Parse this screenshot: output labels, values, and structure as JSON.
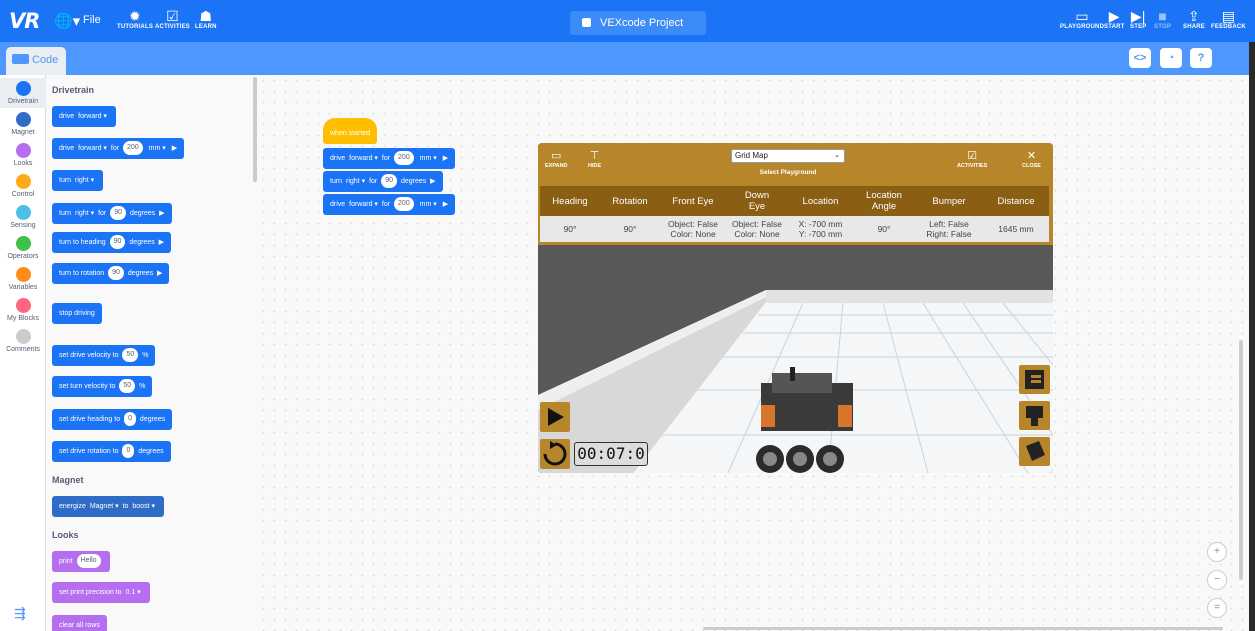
{
  "topbar": {
    "logo": "VR",
    "globe_icon": "globe-icon",
    "file_label": "File",
    "tutorials_label": "TUTORIALS",
    "activities_label": "ACTIVITIES",
    "learn_label": "LEARN",
    "project_title": "VEXcode Project",
    "playground_label": "PLAYGROUND",
    "start_label": "START",
    "step_label": "STEP",
    "stop_label": "STOP",
    "share_label": "SHARE",
    "feedback_label": "FEEDBACK"
  },
  "tabs": {
    "code_label": "Code"
  },
  "categories": [
    {
      "label": "Drivetrain",
      "color": "#1a74f5"
    },
    {
      "label": "Magnet",
      "color": "#2f6cc8"
    },
    {
      "label": "Looks",
      "color": "#b56ef0"
    },
    {
      "label": "Control",
      "color": "#ffab19"
    },
    {
      "label": "Sensing",
      "color": "#4cbfe6"
    },
    {
      "label": "Operators",
      "color": "#40bf4a"
    },
    {
      "label": "Variables",
      "color": "#ff8c1a"
    },
    {
      "label": "My Blocks",
      "color": "#ff6680"
    },
    {
      "label": "Comments",
      "color": "#cccccc"
    }
  ],
  "palette": {
    "drivetrain_title": "Drivetrain",
    "drive": {
      "cmd": "drive",
      "dir": "forward"
    },
    "drive_for": {
      "cmd": "drive",
      "dir": "forward",
      "for": "for",
      "value": "200",
      "unit": "mm"
    },
    "turn": {
      "cmd": "turn",
      "dir": "right"
    },
    "turn_for": {
      "cmd": "turn",
      "dir": "right",
      "for": "for",
      "value": "90",
      "unit": "degrees"
    },
    "turn_heading": {
      "text": "turn to heading",
      "value": "90",
      "unit": "degrees"
    },
    "turn_rotation": {
      "text": "turn to rotation",
      "value": "90",
      "unit": "degrees"
    },
    "stop_driving": "stop driving",
    "drive_velocity": {
      "text": "set drive velocity to",
      "value": "50",
      "unit": "%"
    },
    "turn_velocity": {
      "text": "set turn velocity to",
      "value": "50",
      "unit": "%"
    },
    "drive_heading": {
      "text": "set drive heading to",
      "value": "0",
      "unit": "degrees"
    },
    "drive_rotation": {
      "text": "set drive rotation to",
      "value": "0",
      "unit": "degrees"
    },
    "magnet_title": "Magnet",
    "energize": {
      "cmd": "energize",
      "device": "Magnet",
      "to": "to",
      "mode": "boost"
    },
    "looks_title": "Looks",
    "print": {
      "cmd": "print",
      "value": "Hello"
    },
    "precision": {
      "text": "set print precision to",
      "value": "0.1"
    },
    "clear_rows": "clear all rows"
  },
  "script": {
    "hat": "when started",
    "b1": {
      "cmd": "drive",
      "dir": "forward",
      "for": "for",
      "value": "200",
      "unit": "mm"
    },
    "b2": {
      "cmd": "turn",
      "dir": "right",
      "for": "for",
      "value": "90",
      "unit": "degrees"
    },
    "b3": {
      "cmd": "drive",
      "dir": "forward",
      "for": "for",
      "value": "200",
      "unit": "mm"
    }
  },
  "playground": {
    "expand_label": "EXPAND",
    "hide_label": "HIDE",
    "map_select": "Grid Map",
    "select_label": "Select Playground",
    "activities_label": "ACTIVITIES",
    "close_label": "CLOSE",
    "headers": [
      "Heading",
      "Rotation",
      "Front Eye",
      "Down Eye",
      "Location",
      "Location Angle",
      "Bumper",
      "Distance"
    ],
    "values": {
      "heading": "90°",
      "rotation": "90°",
      "front_eye_1": "Object: False",
      "front_eye_2": "Color: None",
      "down_eye_1": "Object: False",
      "down_eye_2": "Color: None",
      "location_x": "X: -700 mm",
      "location_y": "Y: -700 mm",
      "location_angle": "90°",
      "bumper_left": "Left: False",
      "bumper_right": "Right: False",
      "distance": "1645 mm"
    },
    "timer": "00:07:0"
  },
  "zoom": {
    "in": "+",
    "out": "−",
    "reset": "="
  }
}
